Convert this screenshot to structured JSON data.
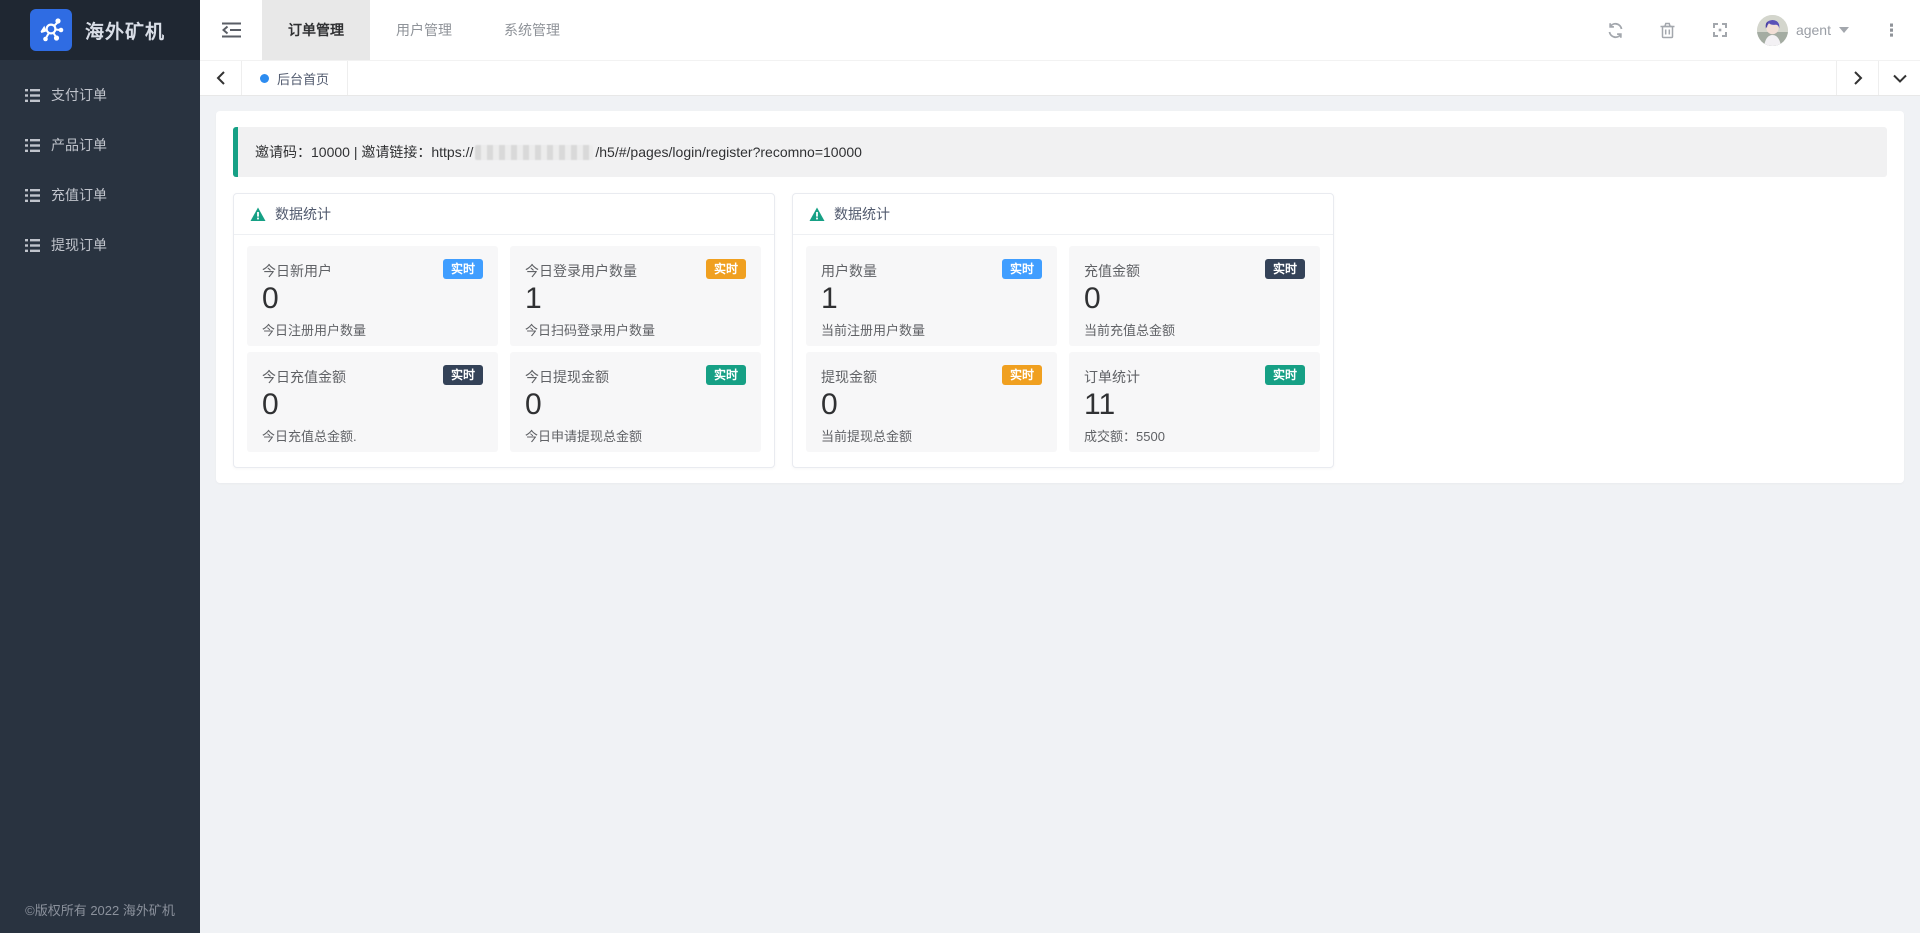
{
  "app": {
    "title": "海外矿机",
    "copyright": "©版权所有 2022 海外矿机"
  },
  "sidebar": {
    "items": [
      {
        "label": "支付订单"
      },
      {
        "label": "产品订单"
      },
      {
        "label": "充值订单"
      },
      {
        "label": "提现订单"
      }
    ]
  },
  "header": {
    "tabs": [
      {
        "label": "订单管理",
        "active": true
      },
      {
        "label": "用户管理",
        "active": false
      },
      {
        "label": "系统管理",
        "active": false
      }
    ],
    "user": {
      "name": "agent"
    }
  },
  "tagbar": {
    "active_tab": "后台首页"
  },
  "banner": {
    "prefix": "邀请码：10000 | 邀请链接：https://",
    "redacted": "[已打码域名]",
    "suffix": "/h5/#/pages/login/register?recomno=10000"
  },
  "colors": {
    "accent_teal": "#16a085",
    "badge_blue": "#409eff",
    "badge_yellow": "#f0a020",
    "badge_navy": "#344258",
    "badge_teal": "#16a085",
    "logo_blue": "#2f6ce3",
    "tag_dot_blue": "#2d8cf0"
  },
  "cards": [
    {
      "title": "数据统计",
      "tiles": [
        {
          "label": "今日新用户",
          "badge": "实时",
          "badge_color": "#409eff",
          "value": "0",
          "subtitle": "今日注册用户数量"
        },
        {
          "label": "今日登录用户数量",
          "badge": "实时",
          "badge_color": "#f0a020",
          "value": "1",
          "subtitle": "今日扫码登录用户数量"
        },
        {
          "label": "今日充值金额",
          "badge": "实时",
          "badge_color": "#344258",
          "value": "0",
          "subtitle": "今日充值总金额."
        },
        {
          "label": "今日提现金额",
          "badge": "实时",
          "badge_color": "#16a085",
          "value": "0",
          "subtitle": "今日申请提现总金额"
        }
      ]
    },
    {
      "title": "数据统计",
      "tiles": [
        {
          "label": "用户数量",
          "badge": "实时",
          "badge_color": "#409eff",
          "value": "1",
          "subtitle": "当前注册用户数量"
        },
        {
          "label": "充值金额",
          "badge": "实时",
          "badge_color": "#344258",
          "value": "0",
          "subtitle": "当前充值总金额"
        },
        {
          "label": "提现金额",
          "badge": "实时",
          "badge_color": "#f0a020",
          "value": "0",
          "subtitle": "当前提现总金额"
        },
        {
          "label": "订单统计",
          "badge": "实时",
          "badge_color": "#16a085",
          "value": "11",
          "subtitle": "成交额：5500"
        }
      ]
    }
  ]
}
